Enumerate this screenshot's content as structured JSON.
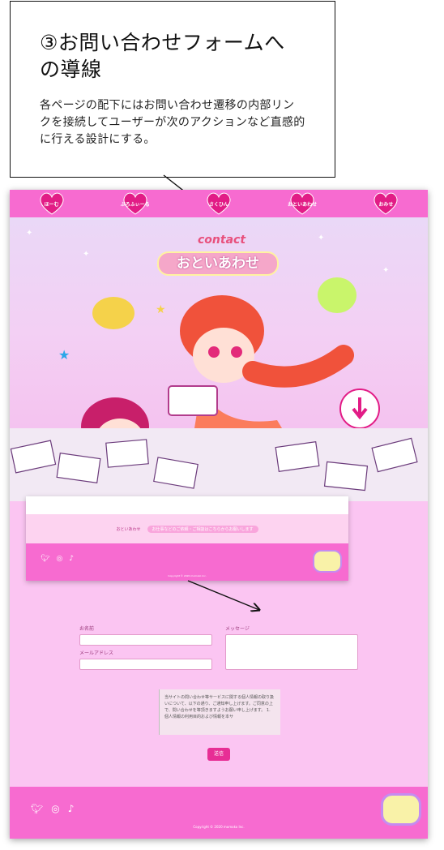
{
  "note": {
    "title": "③お問い合わせフォームへの導線",
    "body": "各ページの配下にはお問い合わせ遷移の内部リンクを接続してユーザーが次のアクションなど直感的に行える設計にする。"
  },
  "nav": {
    "items": [
      "ほーむ",
      "ぷろふぃーる",
      "さくひん",
      "おといあわせ",
      "おみせ"
    ]
  },
  "hero": {
    "logo_top": "contact",
    "logo_main": "おといあわせ"
  },
  "mini_footer": {
    "link1": "おといあわせ",
    "link2": "お仕事などのご依頼・ご相談はこちらからお願いします",
    "copyright": "Copyright © 2020 momoko Inc."
  },
  "form": {
    "name_label": "お名前",
    "email_label": "メールアドレス",
    "message_label": "メッセージ",
    "policy_text": "当サイトの問い合わせ等サービスに関する個人情報の取り扱いについて、以下の通り、ご通知申し上げます。ご同意の上で、問い合わせを等頂きますようお願い申し上げます。 1. 個人情報の利用目的および情報を本サ",
    "submit": "送信"
  },
  "footer": {
    "copyright": "Copyright © 2020 momoko Inc."
  },
  "colors": {
    "nav": "#f76bd0",
    "form_bg": "#fbc5f2",
    "button": "#e72e95"
  }
}
